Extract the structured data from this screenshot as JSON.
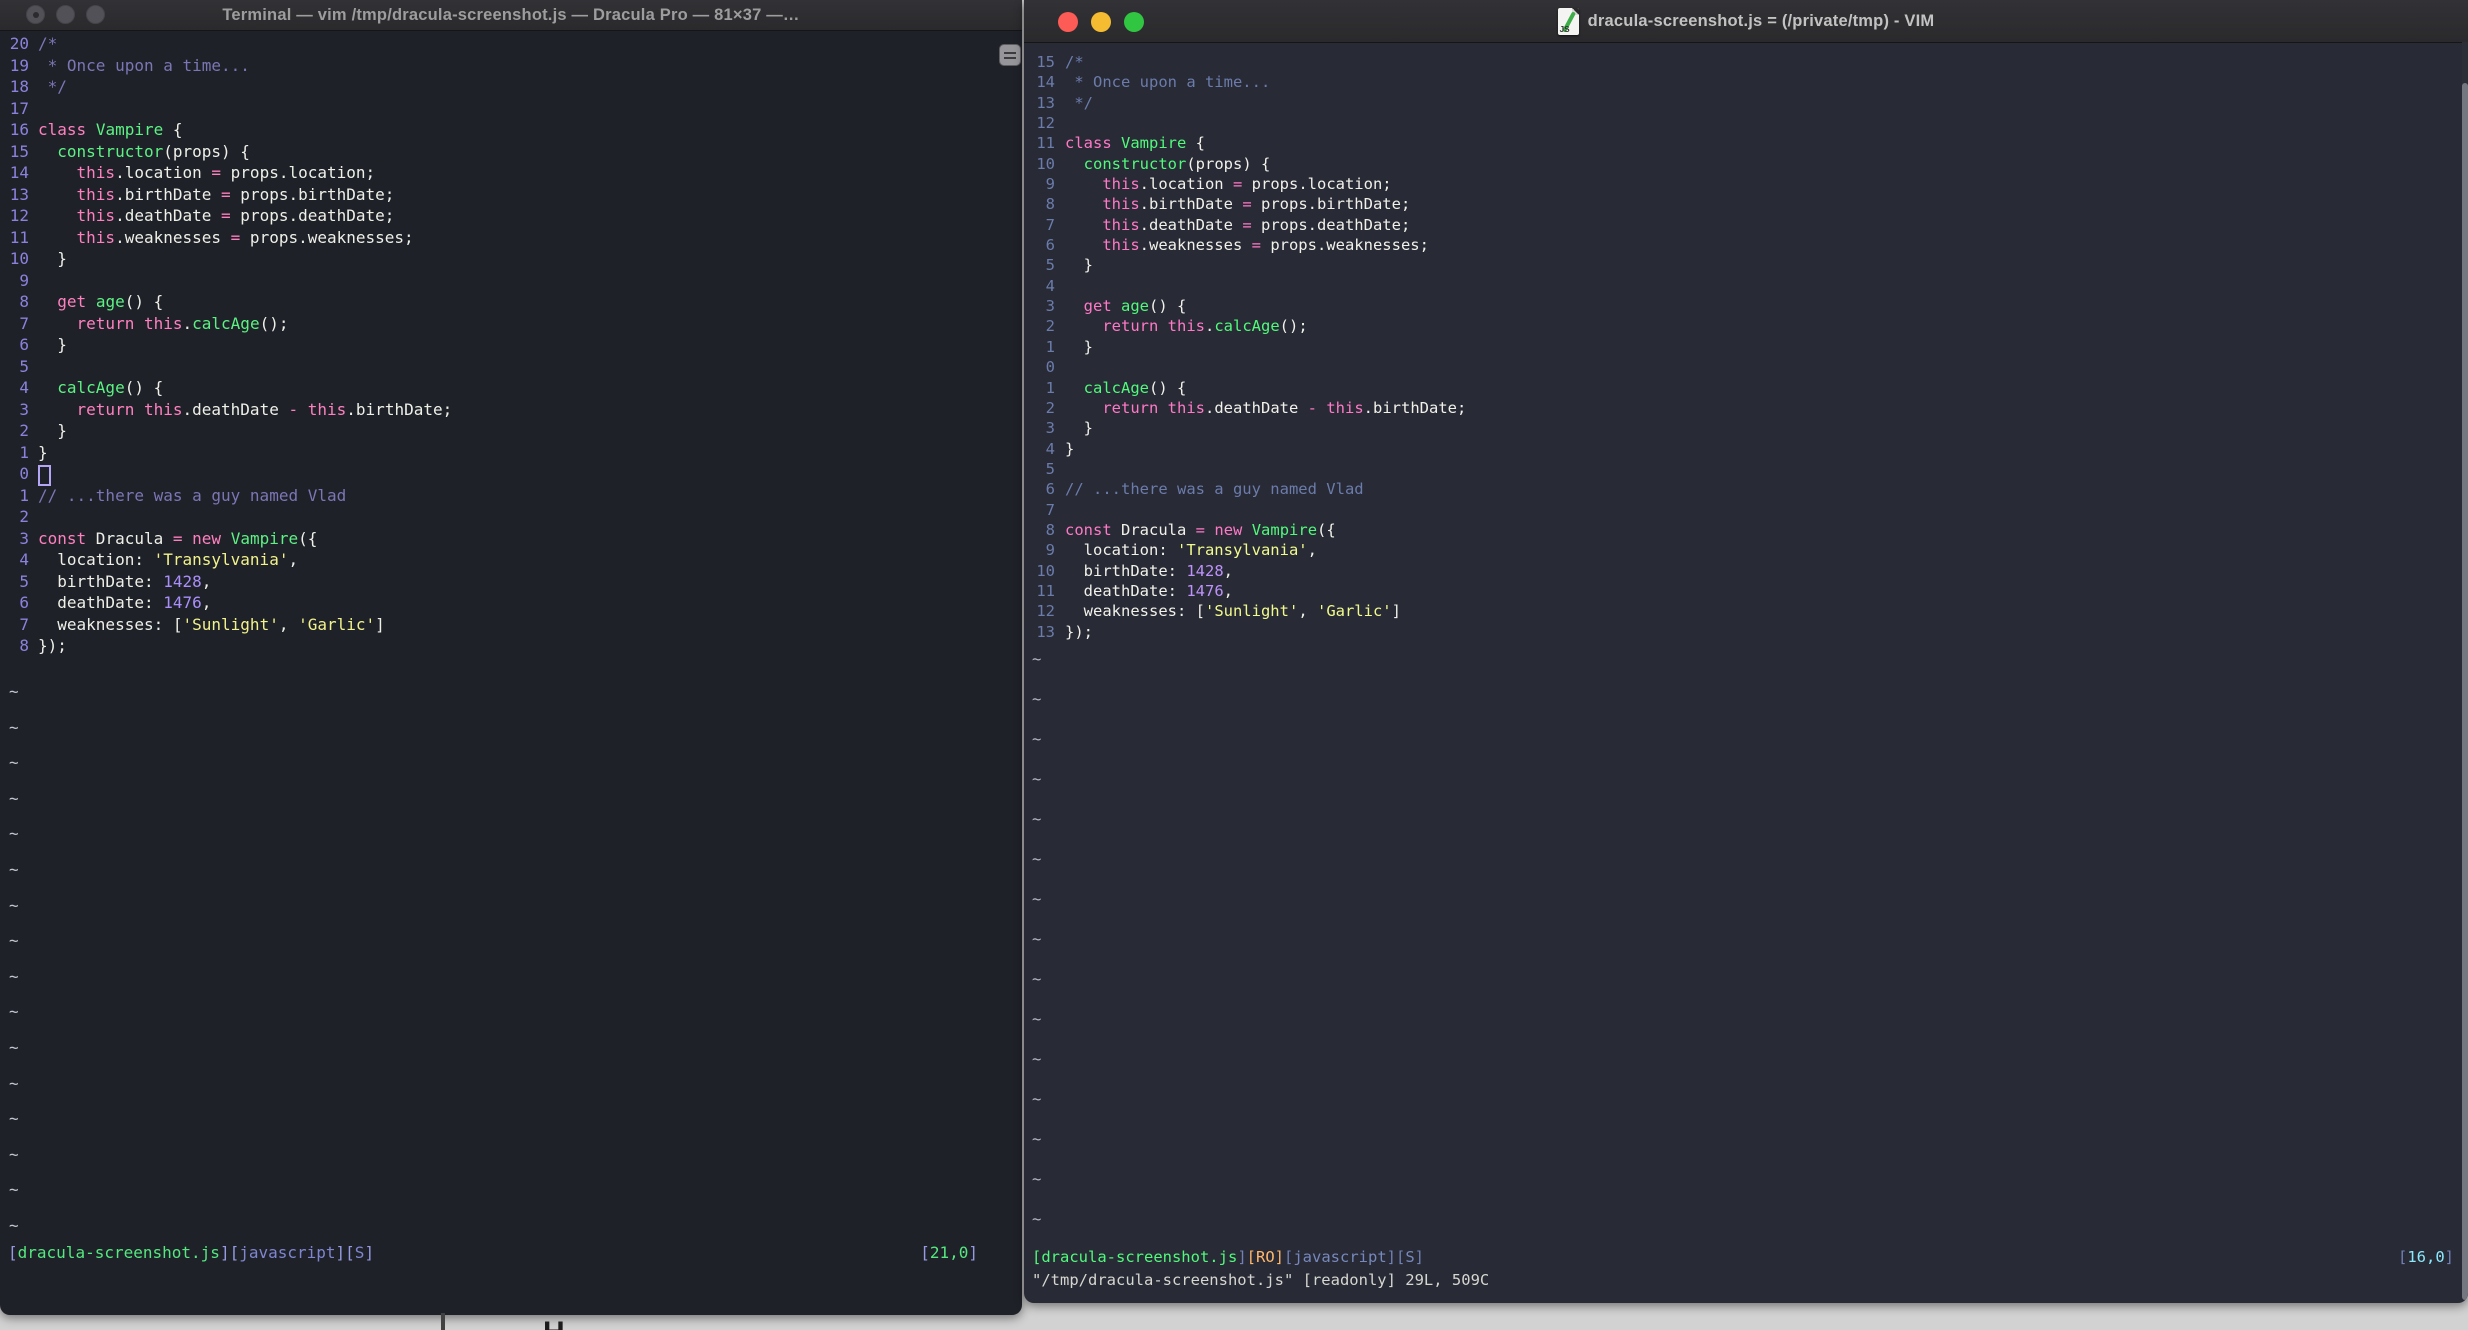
{
  "left_window": {
    "title": "Terminal — vim /tmp/dracula-screenshot.js — Dracula Pro — 81×37 —…",
    "theme_name": "Dracula Pro",
    "terminal_size": "81×37",
    "lines": [
      {
        "n": "20",
        "t": [
          [
            "c",
            "/*"
          ]
        ]
      },
      {
        "n": "19",
        "t": [
          [
            "c",
            " * Once upon a time..."
          ]
        ]
      },
      {
        "n": "18",
        "t": [
          [
            "c",
            " */"
          ]
        ]
      },
      {
        "n": "17",
        "t": []
      },
      {
        "n": "16",
        "t": [
          [
            "k",
            "class"
          ],
          [
            "p",
            " "
          ],
          [
            "f",
            "Vampire"
          ],
          [
            "p",
            " {"
          ]
        ]
      },
      {
        "n": "15",
        "t": [
          [
            "p",
            "  "
          ],
          [
            "f",
            "constructor"
          ],
          [
            "p",
            "(props) {"
          ]
        ]
      },
      {
        "n": "14",
        "t": [
          [
            "p",
            "    "
          ],
          [
            "k",
            "this"
          ],
          [
            "p",
            ".location "
          ],
          [
            "k",
            "="
          ],
          [
            "p",
            " props.location;"
          ]
        ]
      },
      {
        "n": "13",
        "t": [
          [
            "p",
            "    "
          ],
          [
            "k",
            "this"
          ],
          [
            "p",
            ".birthDate "
          ],
          [
            "k",
            "="
          ],
          [
            "p",
            " props.birthDate;"
          ]
        ]
      },
      {
        "n": "12",
        "t": [
          [
            "p",
            "    "
          ],
          [
            "k",
            "this"
          ],
          [
            "p",
            ".deathDate "
          ],
          [
            "k",
            "="
          ],
          [
            "p",
            " props.deathDate;"
          ]
        ]
      },
      {
        "n": "11",
        "t": [
          [
            "p",
            "    "
          ],
          [
            "k",
            "this"
          ],
          [
            "p",
            ".weaknesses "
          ],
          [
            "k",
            "="
          ],
          [
            "p",
            " props.weaknesses;"
          ]
        ]
      },
      {
        "n": "10",
        "t": [
          [
            "p",
            "  }"
          ]
        ]
      },
      {
        "n": " 9",
        "t": []
      },
      {
        "n": " 8",
        "t": [
          [
            "p",
            "  "
          ],
          [
            "k",
            "get"
          ],
          [
            "p",
            " "
          ],
          [
            "f",
            "age"
          ],
          [
            "p",
            "() {"
          ]
        ]
      },
      {
        "n": " 7",
        "t": [
          [
            "p",
            "    "
          ],
          [
            "k",
            "return"
          ],
          [
            "p",
            " "
          ],
          [
            "k",
            "this"
          ],
          [
            "p",
            "."
          ],
          [
            "f",
            "calcAge"
          ],
          [
            "p",
            "();"
          ]
        ]
      },
      {
        "n": " 6",
        "t": [
          [
            "p",
            "  }"
          ]
        ]
      },
      {
        "n": " 5",
        "t": []
      },
      {
        "n": " 4",
        "t": [
          [
            "p",
            "  "
          ],
          [
            "f",
            "calcAge"
          ],
          [
            "p",
            "() {"
          ]
        ]
      },
      {
        "n": " 3",
        "t": [
          [
            "p",
            "    "
          ],
          [
            "k",
            "return"
          ],
          [
            "p",
            " "
          ],
          [
            "k",
            "this"
          ],
          [
            "p",
            ".deathDate "
          ],
          [
            "k",
            "-"
          ],
          [
            "p",
            " "
          ],
          [
            "k",
            "this"
          ],
          [
            "p",
            ".birthDate;"
          ]
        ]
      },
      {
        "n": " 2",
        "t": [
          [
            "p",
            "  }"
          ]
        ]
      },
      {
        "n": " 1",
        "t": [
          [
            "p",
            "}"
          ]
        ]
      },
      {
        "n": " 0",
        "t": [
          [
            "cursor",
            ""
          ]
        ]
      },
      {
        "n": " 1",
        "t": [
          [
            "c",
            "// ...there was a guy named Vlad"
          ]
        ]
      },
      {
        "n": " 2",
        "t": []
      },
      {
        "n": " 3",
        "t": [
          [
            "k",
            "const"
          ],
          [
            "p",
            " Dracula "
          ],
          [
            "k",
            "="
          ],
          [
            "p",
            " "
          ],
          [
            "k",
            "new"
          ],
          [
            "p",
            " "
          ],
          [
            "f",
            "Vampire"
          ],
          [
            "p",
            "({"
          ]
        ]
      },
      {
        "n": " 4",
        "t": [
          [
            "p",
            "  location: "
          ],
          [
            "s",
            "'Transylvania'"
          ],
          [
            "p",
            ","
          ]
        ]
      },
      {
        "n": " 5",
        "t": [
          [
            "p",
            "  birthDate: "
          ],
          [
            "d",
            "1428"
          ],
          [
            "p",
            ","
          ]
        ]
      },
      {
        "n": " 6",
        "t": [
          [
            "p",
            "  deathDate: "
          ],
          [
            "d",
            "1476"
          ],
          [
            "p",
            ","
          ]
        ]
      },
      {
        "n": " 7",
        "t": [
          [
            "p",
            "  weaknesses: ["
          ],
          [
            "s",
            "'Sunlight'"
          ],
          [
            "p",
            ", "
          ],
          [
            "s",
            "'Garlic'"
          ],
          [
            "p",
            "]"
          ]
        ]
      },
      {
        "n": " 8",
        "t": [
          [
            "p",
            "});"
          ]
        ]
      }
    ],
    "tilde_count": 16,
    "status_left": [
      [
        "b",
        "["
      ],
      [
        "file",
        "dracula-screenshot.js"
      ],
      [
        "b",
        "]["
      ],
      [
        "txt",
        "javascript"
      ],
      [
        "b",
        "]["
      ],
      [
        "txt",
        "S"
      ],
      [
        "b",
        "]"
      ]
    ],
    "status_right": [
      [
        "b",
        "["
      ],
      [
        "pos",
        "21,0"
      ],
      [
        "b",
        "]"
      ]
    ]
  },
  "right_window": {
    "title": "dracula-screenshot.js = (/private/tmp) - VIM",
    "doc_icon_label": "JS",
    "lines": [
      {
        "n": "15",
        "t": [
          [
            "c",
            "/*"
          ]
        ]
      },
      {
        "n": "14",
        "t": [
          [
            "c",
            " * Once upon a time..."
          ]
        ]
      },
      {
        "n": "13",
        "t": [
          [
            "c",
            " */"
          ]
        ]
      },
      {
        "n": "12",
        "t": []
      },
      {
        "n": "11",
        "t": [
          [
            "k",
            "class"
          ],
          [
            "p",
            " "
          ],
          [
            "f",
            "Vampire"
          ],
          [
            "p",
            " {"
          ]
        ]
      },
      {
        "n": "10",
        "t": [
          [
            "p",
            "  "
          ],
          [
            "f",
            "constructor"
          ],
          [
            "p",
            "(props) {"
          ]
        ]
      },
      {
        "n": " 9",
        "t": [
          [
            "p",
            "    "
          ],
          [
            "k",
            "this"
          ],
          [
            "p",
            ".location "
          ],
          [
            "k",
            "="
          ],
          [
            "p",
            " props.location;"
          ]
        ]
      },
      {
        "n": " 8",
        "t": [
          [
            "p",
            "    "
          ],
          [
            "k",
            "this"
          ],
          [
            "p",
            ".birthDate "
          ],
          [
            "k",
            "="
          ],
          [
            "p",
            " props.birthDate;"
          ]
        ]
      },
      {
        "n": " 7",
        "t": [
          [
            "p",
            "    "
          ],
          [
            "k",
            "this"
          ],
          [
            "p",
            ".deathDate "
          ],
          [
            "k",
            "="
          ],
          [
            "p",
            " props.deathDate;"
          ]
        ]
      },
      {
        "n": " 6",
        "t": [
          [
            "p",
            "    "
          ],
          [
            "k",
            "this"
          ],
          [
            "p",
            ".weaknesses "
          ],
          [
            "k",
            "="
          ],
          [
            "p",
            " props.weaknesses;"
          ]
        ]
      },
      {
        "n": " 5",
        "t": [
          [
            "p",
            "  }"
          ]
        ]
      },
      {
        "n": " 4",
        "t": []
      },
      {
        "n": " 3",
        "t": [
          [
            "p",
            "  "
          ],
          [
            "k",
            "get"
          ],
          [
            "p",
            " "
          ],
          [
            "f",
            "age"
          ],
          [
            "p",
            "() {"
          ]
        ]
      },
      {
        "n": " 2",
        "t": [
          [
            "p",
            "    "
          ],
          [
            "k",
            "return"
          ],
          [
            "p",
            " "
          ],
          [
            "k",
            "this"
          ],
          [
            "p",
            "."
          ],
          [
            "f",
            "calcAge"
          ],
          [
            "p",
            "();"
          ]
        ]
      },
      {
        "n": " 1",
        "t": [
          [
            "p",
            "  }"
          ]
        ]
      },
      {
        "n": " 0",
        "t": []
      },
      {
        "n": " 1",
        "t": [
          [
            "p",
            "  "
          ],
          [
            "f",
            "calcAge"
          ],
          [
            "p",
            "() {"
          ]
        ]
      },
      {
        "n": " 2",
        "t": [
          [
            "p",
            "    "
          ],
          [
            "k",
            "return"
          ],
          [
            "p",
            " "
          ],
          [
            "k",
            "this"
          ],
          [
            "p",
            ".deathDate "
          ],
          [
            "k",
            "-"
          ],
          [
            "p",
            " "
          ],
          [
            "k",
            "this"
          ],
          [
            "p",
            ".birthDate;"
          ]
        ]
      },
      {
        "n": " 3",
        "t": [
          [
            "p",
            "  }"
          ]
        ]
      },
      {
        "n": " 4",
        "t": [
          [
            "p",
            "}"
          ]
        ]
      },
      {
        "n": " 5",
        "t": []
      },
      {
        "n": " 6",
        "t": [
          [
            "c",
            "// ...there was a guy named Vlad"
          ]
        ]
      },
      {
        "n": " 7",
        "t": []
      },
      {
        "n": " 8",
        "t": [
          [
            "k",
            "const"
          ],
          [
            "p",
            " Dracula "
          ],
          [
            "k",
            "="
          ],
          [
            "p",
            " "
          ],
          [
            "k",
            "new"
          ],
          [
            "p",
            " "
          ],
          [
            "f",
            "Vampire"
          ],
          [
            "p",
            "({"
          ]
        ]
      },
      {
        "n": " 9",
        "t": [
          [
            "p",
            "  location: "
          ],
          [
            "s",
            "'Transylvania'"
          ],
          [
            "p",
            ","
          ]
        ]
      },
      {
        "n": "10",
        "t": [
          [
            "p",
            "  birthDate: "
          ],
          [
            "d",
            "1428"
          ],
          [
            "p",
            ","
          ]
        ]
      },
      {
        "n": "11",
        "t": [
          [
            "p",
            "  deathDate: "
          ],
          [
            "d",
            "1476"
          ],
          [
            "p",
            ","
          ]
        ]
      },
      {
        "n": "12",
        "t": [
          [
            "p",
            "  weaknesses: ["
          ],
          [
            "s",
            "'Sunlight'"
          ],
          [
            "p",
            ", "
          ],
          [
            "s",
            "'Garlic'"
          ],
          [
            "p",
            "]"
          ]
        ]
      },
      {
        "n": "13",
        "t": [
          [
            "p",
            "});"
          ]
        ]
      }
    ],
    "tilde_count": 15,
    "status_left": [
      [
        "file",
        "[dracula-screenshot.js"
      ],
      [
        "b",
        "]"
      ],
      [
        "ro",
        "[RO]"
      ],
      [
        "b",
        "["
      ],
      [
        "txt",
        "javascript"
      ],
      [
        "b",
        "]["
      ],
      [
        "txt",
        "S"
      ],
      [
        "b",
        "]"
      ]
    ],
    "status_right": [
      [
        "b",
        "["
      ],
      [
        "pos",
        "16,0"
      ],
      [
        "b",
        "]"
      ]
    ],
    "ex_line": "\"/tmp/dracula-screenshot.js\" [readonly] 29L, 509C"
  },
  "desktop": {
    "background": "#d2d2d2",
    "partial_glyph": "H"
  },
  "palette": {
    "traffic": {
      "inactive": "#515157",
      "red": "#fd5b55",
      "yellow": "#f6bc31",
      "green": "#30c641"
    },
    "left": {
      "bg": "#1f2129",
      "cm": "#7b76b4",
      "kw": "#ff80bf",
      "fn": "#5cf283",
      "st": "#f1f28b",
      "nm": "#a98ffa",
      "fg": "#eef0e8",
      "cur": "#b3a6f5",
      "tl": "#c3c7cf",
      "ln": "#8b82dd",
      "sb": "#959ae2",
      "sf": "#54e87f",
      "stx": "#7f86cf",
      "sp": "#54e87f",
      "sro": "#ffb86c"
    },
    "right": {
      "bg": "#282a36",
      "cm": "#6b7cab",
      "kw": "#ff79c6",
      "fn": "#50fa7b",
      "st": "#f1fa8c",
      "nm": "#bd93f9",
      "fg": "#f1f1ea",
      "cur": "#b3a6f5",
      "tl": "#b8bcc6",
      "ln": "#6b7cab",
      "sb": "#6f81b5",
      "sf": "#50fa7b",
      "stx": "#7688bc",
      "sp": "#8be9fd",
      "sro": "#ffb86c"
    }
  }
}
